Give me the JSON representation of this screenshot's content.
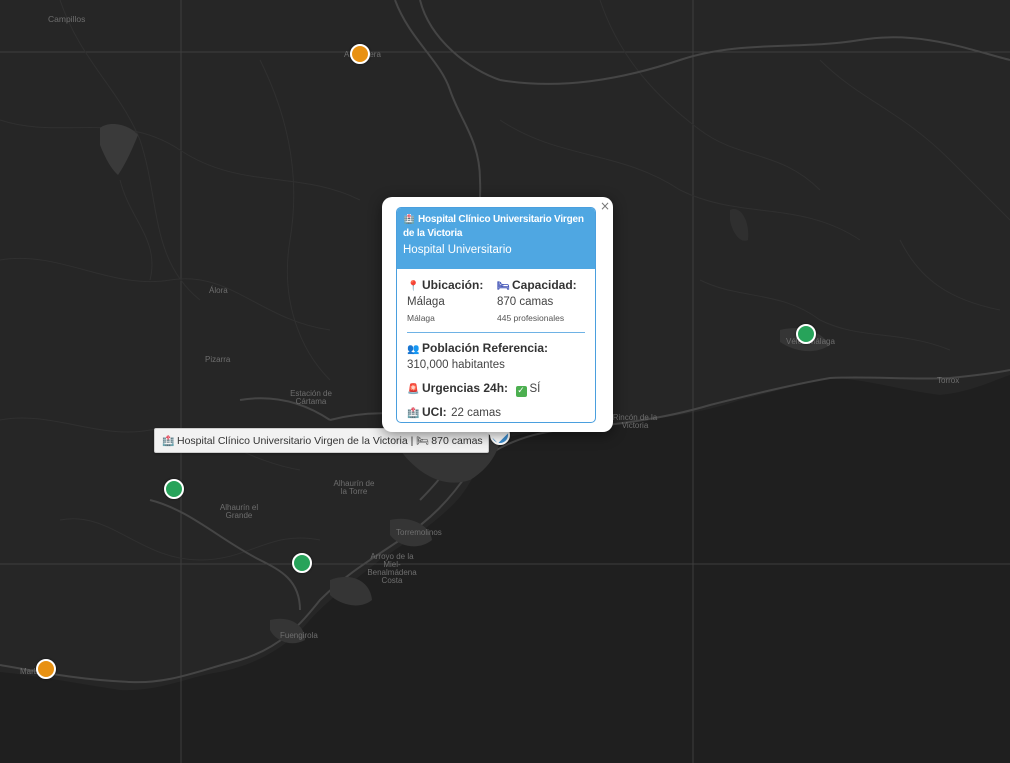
{
  "map": {
    "colors": {
      "land": "#262626",
      "sea": "#1f1f1f",
      "roads": "#3b3b3b",
      "grid": "#3e3e3e"
    },
    "places": [
      {
        "name": "Campillos"
      },
      {
        "name": "Álora"
      },
      {
        "name": "Pizarra"
      },
      {
        "name": "Estación de Cártama"
      },
      {
        "name": "Alhaurín de la Torre"
      },
      {
        "name": "Alhaurín el Grande"
      },
      {
        "name": "Torremolinos"
      },
      {
        "name": "Arroyo de la Miel-Benalmádena Costa"
      },
      {
        "name": "Fuengirola"
      },
      {
        "name": "Rincón de la Victoria"
      },
      {
        "name": "Torrox"
      },
      {
        "name": "Vélez-Málaga"
      },
      {
        "name": "Marbella"
      },
      {
        "name": "Antequera"
      }
    ],
    "markers": [
      {
        "id": "orange-1",
        "color": "#e89112"
      },
      {
        "id": "green-1",
        "color": "#27a35a"
      },
      {
        "id": "green-2",
        "color": "#27a35a"
      },
      {
        "id": "green-3",
        "color": "#27a35a"
      },
      {
        "id": "orange-2",
        "color": "#e89112"
      },
      {
        "id": "selected",
        "color": "#3d8fd1"
      }
    ]
  },
  "popup": {
    "title_icon": "hospital-icon",
    "title": "Hospital Clínico Universitario Virgen de la Victoria",
    "subtitle": "Hospital Universitario",
    "header_color": "#4fa7e2",
    "location": {
      "icon": "pin-icon",
      "label": "Ubicación:",
      "value": "Málaga",
      "detail": "Málaga"
    },
    "capacity": {
      "icon": "bed-icon",
      "label": "Capacidad:",
      "value": "870 camas",
      "detail": "445 profesionales"
    },
    "population": {
      "icon": "people-icon",
      "label": "Población Referencia:",
      "value": "310,000 habitantes"
    },
    "emergency": {
      "icon": "ambulance-light-icon",
      "label": "Urgencias 24h:",
      "value": "SÍ",
      "check_icon": "checkmark-icon"
    },
    "icu": {
      "icon": "hospital-icon",
      "label": "UCI:",
      "value": "22 camas"
    },
    "close": "×"
  },
  "tooltip": {
    "icon1": "hospital-icon",
    "name": "Hospital Clínico Universitario Virgen de la Victoria",
    "sep": "|",
    "icon2": "bed-icon",
    "beds": "870 camas"
  }
}
